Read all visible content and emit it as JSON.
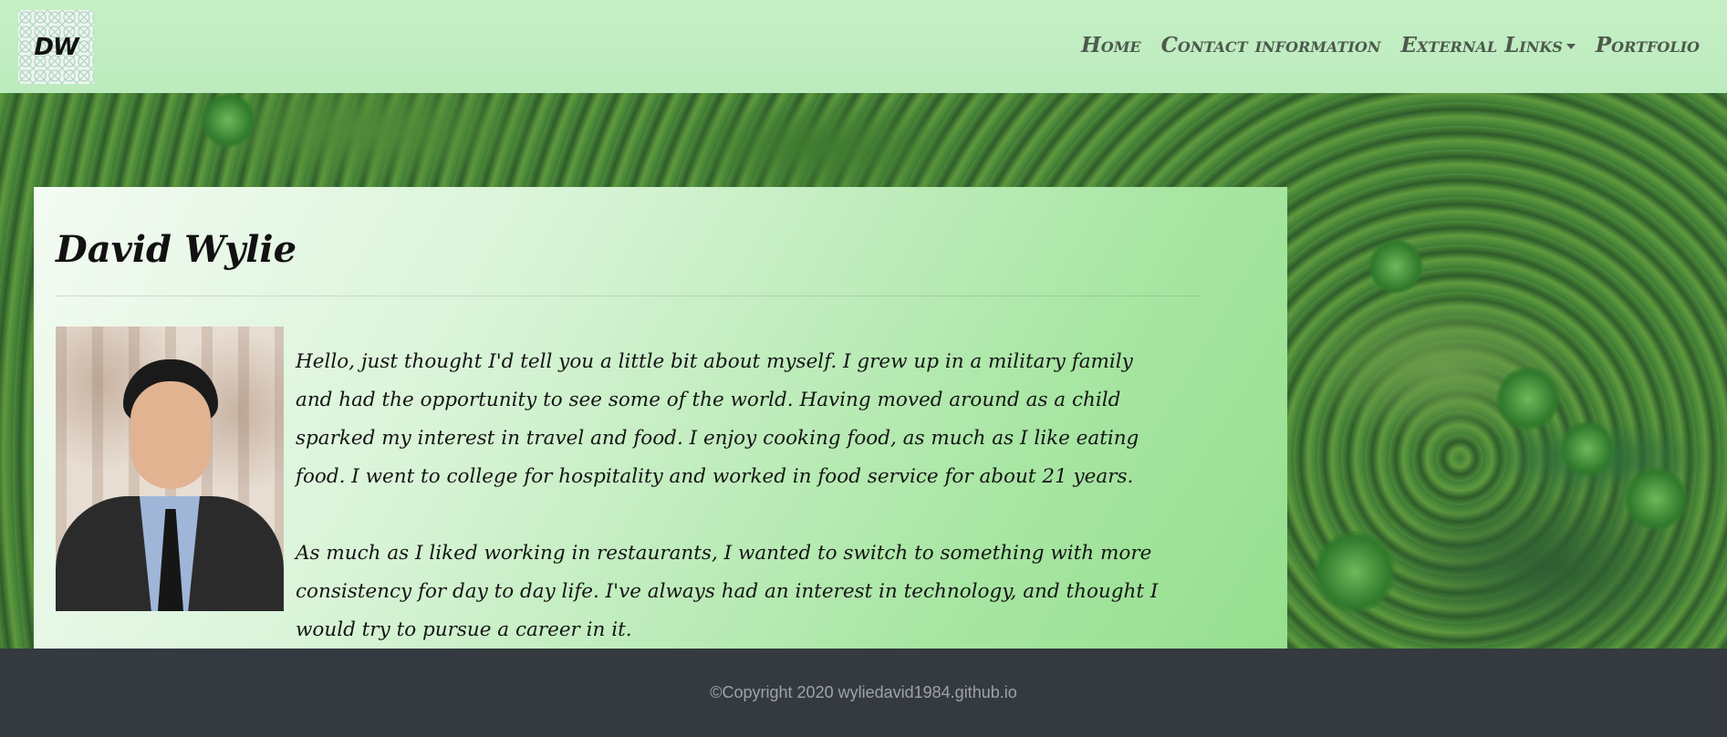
{
  "navbar": {
    "logo_text": "DW",
    "items": [
      {
        "label": "Home"
      },
      {
        "label": "Contact information"
      },
      {
        "label": "External Links"
      },
      {
        "label": "Portfolio"
      }
    ]
  },
  "main": {
    "title": "David Wylie",
    "paragraphs": [
      "Hello, just thought I'd tell you a little bit about myself. I grew up in a military family and had the opportunity to see some of the world. Having moved around as a child sparked my interest in travel and food. I enjoy cooking food, as much as I like eating food. I went to college for hospitality and worked in food service for about 21 years.",
      "As much as I liked working in restaurants, I wanted to switch to something with more consistency for day to day life. I've always had an interest in technology, and thought I would try to pursue a career in it."
    ]
  },
  "footer": {
    "text": "©Copyright 2020 wyliedavid1984.github.io"
  },
  "colors": {
    "navbar_bg": "#c3eec4",
    "footer_bg": "#343a40",
    "nav_text": "#4d5a4d"
  }
}
